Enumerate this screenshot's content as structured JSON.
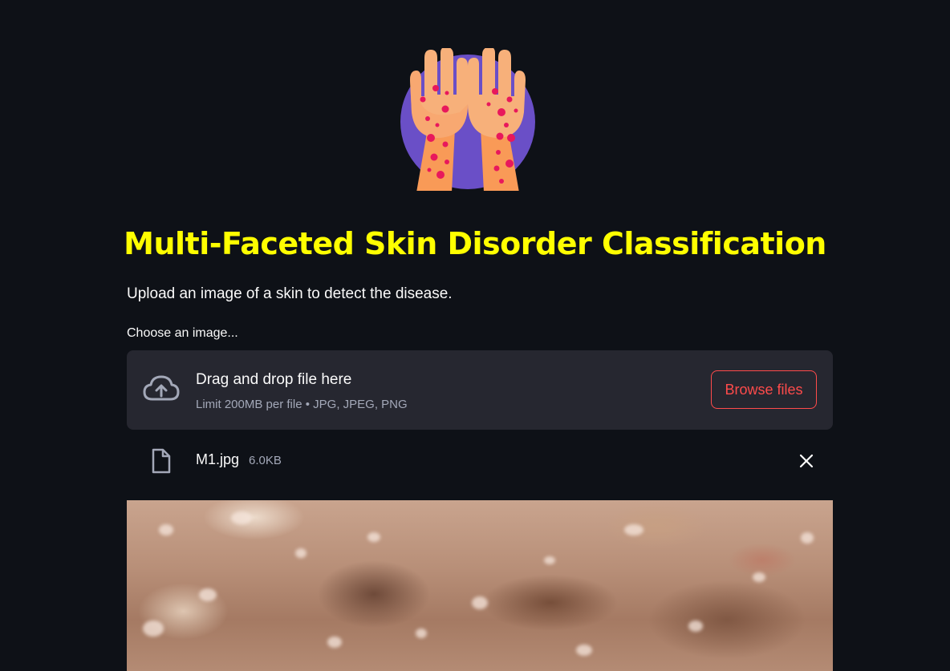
{
  "app": {
    "title": "Multi-Faceted Skin Disorder Classification",
    "subtitle": "Upload an image of a skin to detect the disease.",
    "logo_icon": "rash-hands-icon",
    "title_color": "#ffff00",
    "accent_color": "#ff4b4b",
    "background_color": "#0e1117"
  },
  "uploader": {
    "label": "Choose an image...",
    "drop_text": "Drag and drop file here",
    "limit_text": "Limit 200MB per file • JPG, JPEG, PNG",
    "browse_label": "Browse files",
    "icon": "cloud-upload-icon"
  },
  "uploaded_file": {
    "name": "M1.jpg",
    "size": "6.0KB",
    "icon": "file-icon",
    "remove_icon": "close-icon"
  },
  "preview": {
    "description_icon": "skin-image"
  }
}
